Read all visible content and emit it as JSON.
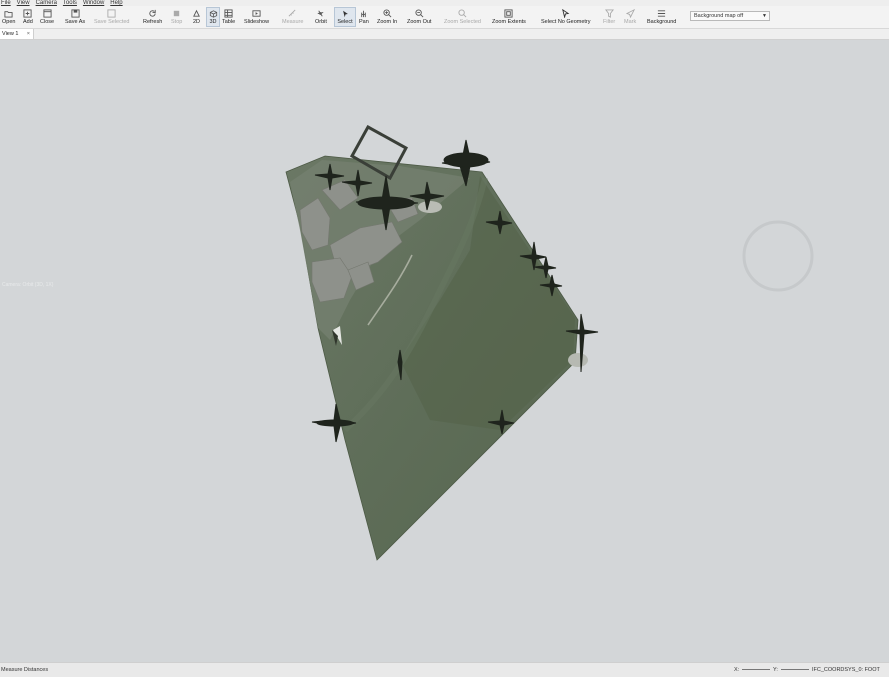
{
  "menu": [
    "File",
    "View",
    "Camera",
    "Tools",
    "Window",
    "Help"
  ],
  "toolbar": {
    "open": "Open",
    "add": "Add",
    "close": "Close",
    "save_as": "Save As",
    "save_selected": "Save Selected",
    "refresh": "Refresh",
    "stop": "Stop",
    "view_2d": "2D",
    "view_3d": "3D",
    "table": "Table",
    "slideshow": "Slideshow",
    "measure": "Measure",
    "orbit": "Orbit",
    "select": "Select",
    "pan": "Pan",
    "zoom_in": "Zoom In",
    "zoom_out": "Zoom Out",
    "zoom_selected": "Zoom Selected",
    "zoom_extents": "Zoom Extents",
    "select_no_geometry": "Select No Geometry",
    "filter": "Filter",
    "mark": "Mark",
    "background": "Background",
    "background_value": "Background map off"
  },
  "tabs": [
    {
      "label": "View 1",
      "close": "×"
    }
  ],
  "viewport": {
    "overlay_label": "Camera: Orbit (3D, 1X)"
  },
  "status": {
    "left": "Measure Distances",
    "x_label": "X:",
    "y_label": "Y:",
    "crs": "IFC_COORDSYS_0: FOOT"
  },
  "colors": {
    "terrain": "#5f6e59",
    "canvas": "#d3d6d8",
    "tree": "#1f241d"
  },
  "icons": [
    "open-icon",
    "add-icon",
    "close-icon",
    "save-icon",
    "refresh-icon",
    "stop-icon",
    "2d-icon",
    "3d-icon",
    "table-icon",
    "slideshow-icon",
    "measure-icon",
    "orbit-icon",
    "select-icon",
    "pan-icon",
    "zoom-in-icon",
    "zoom-out-icon",
    "filter-icon",
    "mark-icon",
    "background-icon"
  ]
}
